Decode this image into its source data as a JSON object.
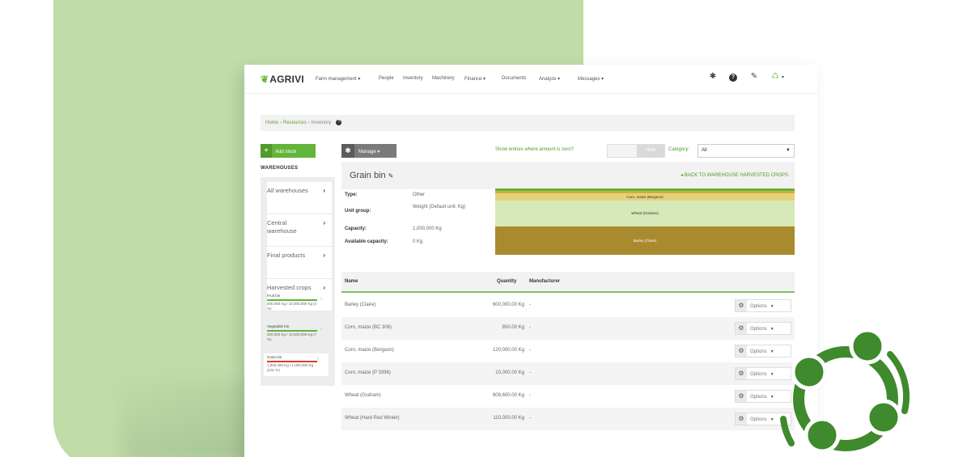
{
  "brand": {
    "logo_text": "AGRIVI",
    "accent": "#62b43b",
    "card_bg": "#bfdca9"
  },
  "nav": {
    "items": [
      "Farm management ▾",
      "People",
      "Inventory",
      "Machinery",
      "Finance ▾",
      "Documents",
      "Analyze ▾",
      "Messages ▾"
    ],
    "icons": [
      "gear-icon",
      "help-icon",
      "bell-icon",
      "recycle-icon"
    ],
    "recycle_caret": "▾"
  },
  "breadcrumb": {
    "home": "Home",
    "resources": "Resources",
    "current": "Inventory",
    "sep": "›"
  },
  "sidebar": {
    "add_stock_label": "Add stock",
    "warehouses_title": "WAREHOUSES",
    "items": [
      {
        "label": "All warehouses"
      },
      {
        "label": "Central warehouse"
      },
      {
        "label": "Final products"
      },
      {
        "label": "Harvested crops"
      }
    ],
    "bins": [
      {
        "name": "Fruit bin",
        "amount": "200,000 Kg / 10,000,000 Kg (4 %)",
        "bar_color": "#62b43b"
      },
      {
        "name": "Vegetable bin",
        "amount": "300,000 Kg / 10,000,000 Kg (7 %)",
        "bar_color": "#62b43b"
      },
      {
        "name": "Grain bin",
        "amount": "1,006,450 Kg / 1,000,000 Kg (101 %)",
        "bar_color": "#e23b2e"
      }
    ]
  },
  "toolbar": {
    "manage_label": "Manage ▾",
    "show_entries_label": "Show entries where amount is zero?",
    "toggle_value": "Hide",
    "category_label": "Category:",
    "category_value": "All"
  },
  "bin": {
    "title": "Grain bin",
    "back_link": "◂ BACK TO WAREHOUSE HARVESTED CROPS",
    "details": [
      {
        "label": "Type:",
        "value": "Other"
      },
      {
        "label": "Unit group:",
        "value": "Weight (Default unit: Kg)"
      },
      {
        "label": "Capacity:",
        "value": "1,000,000 Kg"
      },
      {
        "label": "Available capacity:",
        "value": "0 Kg"
      }
    ],
    "capacity_segments": [
      {
        "label": "",
        "color": "#62b43b",
        "height": 3
      },
      {
        "label": "",
        "color": "#cdb03a",
        "height": 3
      },
      {
        "label": "Corn, maize (Bergoon)",
        "color": "#e6d27a",
        "height": 9
      },
      {
        "label": "Wheat (Graham)",
        "color": "#d5eab8",
        "height": 32
      },
      {
        "label": "Barley (Claire)",
        "color": "#a98a2e",
        "height": 35
      }
    ]
  },
  "table": {
    "headers": {
      "name": "Name",
      "quantity": "Quantity",
      "manufacturer": "Manufacturer"
    },
    "options_label": "Options",
    "rows": [
      {
        "name": "Barley (Claire)",
        "quantity": "600,000.00 Kg",
        "manufacturer": "-"
      },
      {
        "name": "Corn, maize (BC 306)",
        "quantity": "850.00 Kg",
        "manufacturer": "-"
      },
      {
        "name": "Corn, maize (Bergoon)",
        "quantity": "120,000.00 Kg",
        "manufacturer": "-"
      },
      {
        "name": "Corn, maize (P 3396)",
        "quantity": "10,000.00 Kg",
        "manufacturer": "-"
      },
      {
        "name": "Wheat (Graham)",
        "quantity": "608,600.00 Kg",
        "manufacturer": "-"
      },
      {
        "name": "Wheat (Hard Red Winter)",
        "quantity": "110,000.00 Kg",
        "manufacturer": "-"
      }
    ]
  }
}
